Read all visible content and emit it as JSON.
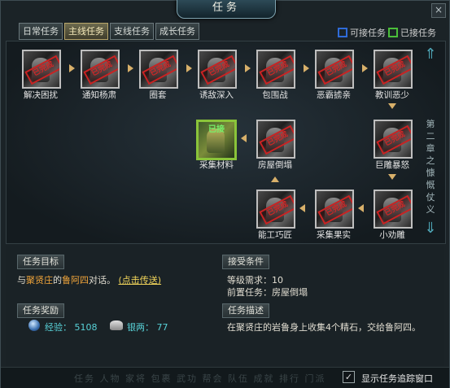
{
  "window": {
    "title": "任务",
    "close": "×"
  },
  "tabs": [
    "日常任务",
    "主线任务",
    "支线任务",
    "成长任务"
  ],
  "active_tab": 1,
  "legend": {
    "available": "可接任务",
    "accepted": "已接任务",
    "available_color": "#2f6bd8",
    "accepted_color": "#4bbf3a"
  },
  "chapter": [
    "第",
    "二",
    "章",
    "之",
    "慷",
    "慨",
    "仗",
    "义"
  ],
  "stamp_text": "已完成",
  "nodes": {
    "n1": "解决困扰",
    "n2": "通知杨肃",
    "n3": "圈套",
    "n4": "诱敌深入",
    "n5": "包围战",
    "n6": "恶霸掳亲",
    "n7": "教训恶少",
    "n8": "巨雕暴怒",
    "n9": "小劝雕",
    "n10": "采集果实",
    "n11": "能工巧匠",
    "n12": "房屋倒塌",
    "n13": "采集材料"
  },
  "current_label": "已接",
  "panels": {
    "goal": {
      "title": "任务目标",
      "prefix": "与",
      "npc1": "聚贤庄",
      "mid": "的",
      "npc2": "鲁阿四",
      "suffix": "对话。",
      "link": "(点击传送)"
    },
    "conditions": {
      "title": "接受条件",
      "level": "等级需求：10",
      "prereq": "前置任务：房屋倒塌"
    },
    "reward": {
      "title": "任务奖励",
      "exp_label": "经验",
      "exp_value": "5108",
      "silver_label": "银两",
      "silver_value": "77",
      "sep": "："
    },
    "desc": {
      "title": "任务描述",
      "text": "在聚贤庄的岩鲁身上收集4个精石，交给鲁阿四。"
    }
  },
  "footer": {
    "track_label": "显示任务追踪窗口",
    "track_checked": "✓",
    "ghost": "任务 人物 家将 包裹 武功 帮会 队伍 成就 排行 门派"
  }
}
